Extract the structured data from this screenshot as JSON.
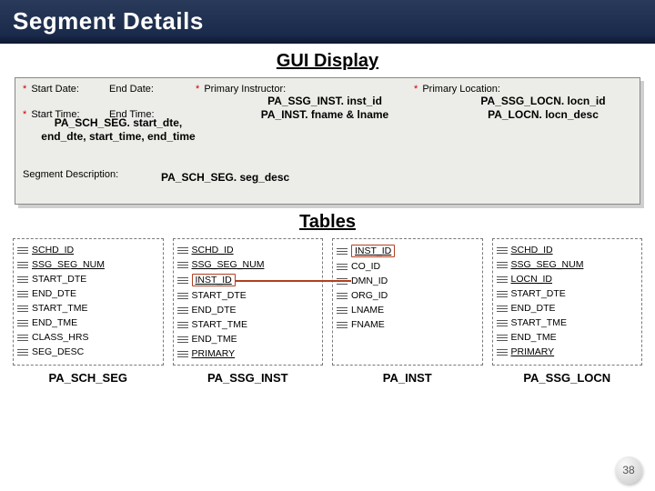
{
  "title": "Segment Details",
  "sections": {
    "gui": "GUI Display",
    "tables": "Tables"
  },
  "gui": {
    "labels": {
      "start_date": "Start Date:",
      "end_date": "End Date:",
      "primary_instructor": "Primary Instructor:",
      "primary_location": "Primary Location:",
      "start_time": "Start Time:",
      "end_time": "End Time:",
      "segment_description": "Segment Description:"
    },
    "annotations": {
      "left_line1": "PA_SCH_SEG. start_dte,",
      "left_line2": "end_dte, start_time, end_time",
      "mid_line1": "PA_SSG_INST. inst_id",
      "mid_line2": "PA_INST. fname & lname",
      "right_line1": "PA_SSG_LOCN. locn_id",
      "right_line2": "PA_LOCN. locn_desc",
      "bottom": "PA_SCH_SEG. seg_desc"
    }
  },
  "tables": [
    {
      "name": "PA_SCH_SEG",
      "columns": [
        {
          "name": "SCHD_ID",
          "key": true
        },
        {
          "name": "SSG_SEG_NUM",
          "key": true
        },
        {
          "name": "START_DTE"
        },
        {
          "name": "END_DTE"
        },
        {
          "name": "START_TME"
        },
        {
          "name": "END_TME"
        },
        {
          "name": "CLASS_HRS"
        },
        {
          "name": "SEG_DESC"
        }
      ]
    },
    {
      "name": "PA_SSG_INST",
      "columns": [
        {
          "name": "SCHD_ID",
          "key": true
        },
        {
          "name": "SSG_SEG_NUM",
          "key": true
        },
        {
          "name": "INST_ID",
          "key": true,
          "boxed": true
        },
        {
          "name": "START_DTE"
        },
        {
          "name": "END_DTE"
        },
        {
          "name": "START_TME"
        },
        {
          "name": "END_TME"
        },
        {
          "name": "PRIMARY",
          "key": true
        }
      ]
    },
    {
      "name": "PA_INST",
      "columns": [
        {
          "name": "INST_ID",
          "key": true,
          "boxed": true
        },
        {
          "name": "CO_ID"
        },
        {
          "name": "DMN_ID"
        },
        {
          "name": "ORG_ID"
        },
        {
          "name": "LNAME"
        },
        {
          "name": "FNAME"
        }
      ]
    },
    {
      "name": "PA_SSG_LOCN",
      "columns": [
        {
          "name": "SCHD_ID",
          "key": true
        },
        {
          "name": "SSG_SEG_NUM",
          "key": true
        },
        {
          "name": "LOCN_ID",
          "key": true
        },
        {
          "name": "START_DTE"
        },
        {
          "name": "END_DTE"
        },
        {
          "name": "START_TME"
        },
        {
          "name": "END_TME"
        },
        {
          "name": "PRIMARY",
          "key": true
        }
      ]
    }
  ],
  "slide_number": "38"
}
